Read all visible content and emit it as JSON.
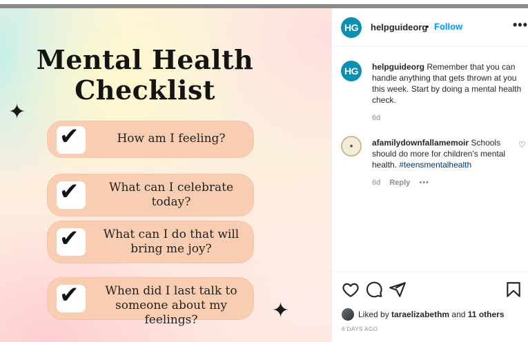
{
  "image": {
    "title_line1": "Mental Health",
    "title_line2": "Checklist",
    "check_glyph": "✔",
    "sparkle_glyph": "✦",
    "items": [
      {
        "line1": "How am I feeling?",
        "line2": ""
      },
      {
        "line1": "What can I celebrate",
        "line2": "today?"
      },
      {
        "line1": "What can I do that will",
        "line2": "bring me joy?"
      },
      {
        "line1": "When did I last talk to",
        "line2": "someone about my feelings?"
      }
    ]
  },
  "header": {
    "avatar_initials": "HG",
    "username": "helpguideorg",
    "separator": "•",
    "follow_label": "Follow",
    "more_label": "•••"
  },
  "caption": {
    "avatar_initials": "HG",
    "username": "helpguideorg",
    "text": "Remember that you can handle anything that gets thrown at you this week. Start by doing a mental health check.",
    "time": "6d"
  },
  "comment": {
    "username": "afamilydownfallamemoir",
    "text": "Schools should do more for children's mental health.",
    "hashtag": "#teensmentalhealth",
    "time": "6d",
    "reply_label": "Reply",
    "more_label": "•••",
    "heart_glyph": "♡"
  },
  "actions": {
    "liked_by_prefix": "Liked by",
    "liked_by_user": "tarаelizabethm",
    "liked_by_and": "and",
    "liked_by_others": "11 others",
    "date": "6 DAYS AGO"
  },
  "colors": {
    "brand_avatar": "#0d8fb2",
    "follow": "#0095f6",
    "item_bg": "#f9cdb2",
    "hashtag": "#00376b",
    "muted": "#8e8e8e"
  }
}
